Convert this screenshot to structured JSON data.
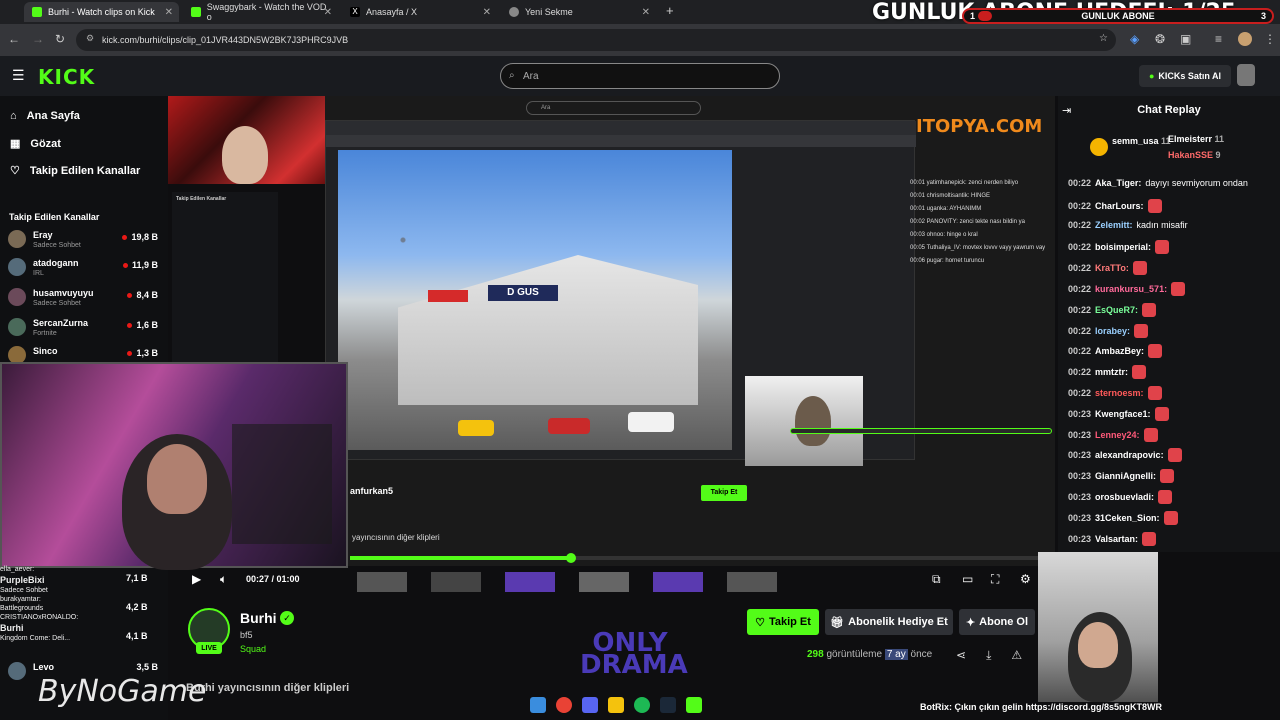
{
  "browser": {
    "tabs": [
      {
        "title": "Burhi - Watch clips on Kick",
        "fav_color": "#53fc18"
      },
      {
        "title": "Swaggybark - Watch the VOD o",
        "fav_color": "#53fc18"
      },
      {
        "title": "Anasayfa / X",
        "fav_color": "#000000"
      },
      {
        "title": "Yeni Sekme",
        "fav_color": "#888888"
      }
    ],
    "url": "kick.com/burhi/clips/clip_01JVR443DN5W2BK7J3PHRC9JVB"
  },
  "overlay_goal": {
    "banner": "GUNLUK ABONE HEDEFI: 1/25",
    "left_num": "1",
    "label": "GUNLUK ABONE",
    "right_num": "3"
  },
  "kick_header": {
    "logo": "KICK",
    "search_placeholder": "Ara",
    "kicks_button": "KICKs Satın Al"
  },
  "sidebar": {
    "nav": [
      {
        "label": "Ana Sayfa",
        "icon": "home-icon"
      },
      {
        "label": "Gözat",
        "icon": "browse-icon"
      },
      {
        "label": "Takip Edilen Kanallar",
        "icon": "heart-icon"
      }
    ],
    "followed_title": "Takip Edilen Kanallar",
    "channels": [
      {
        "name": "Eray",
        "game": "Sadece Sohbet",
        "viewers": "19,8 B",
        "color": "#7a6a55"
      },
      {
        "name": "atadogann",
        "game": "IRL",
        "viewers": "11,9 B",
        "color": "#556b7a"
      },
      {
        "name": "husamvuyuyu",
        "game": "Sadece Sohbet",
        "viewers": "8,4 B",
        "color": "#6b4a5a"
      },
      {
        "name": "SercanZurna",
        "game": "Fortnite",
        "viewers": "1,6 B",
        "color": "#4a6a5a"
      },
      {
        "name": "Sinco",
        "game": "",
        "viewers": "1,3 B",
        "color": "#8a6a3a"
      }
    ]
  },
  "overlay_chat_left": [
    "ella_aever:",
    "PurpleBixi",
    "Sadece Sohbet",
    "burakyamtar:",
    "Battlegrounds",
    "CRISTIANOxRONALDO:",
    "Burhi",
    "Kingdom Come: Deli..."
  ],
  "overlay_side_channels": [
    {
      "name": "PurpleBixi",
      "viewers": "7,1 B"
    },
    {
      "name": "",
      "viewers": "4,2 B"
    },
    {
      "name": "Burhi",
      "viewers": "4,1 B"
    },
    {
      "name": "Levo",
      "viewers": "3,5 B"
    }
  ],
  "video": {
    "watermark": "ITOPYA.COM",
    "inner_chat": [
      "00:01 yatimhanepick: zenci nerden biliyo",
      "00:01 chrismoltisantik: HINGE",
      "00:01 uganka: AYHANIMM",
      "00:02 PANOVITY: zenci tekte nası bildin ya",
      "00:03 ohnoo: hinge o kral",
      "00:05 Tuthaliya_IV: movtex lovvv vayy yawrum vay",
      "00:06 pugar: hornet turuncu"
    ],
    "inner_streamer": "anfurkan5",
    "inner_clips_text": "yayıncısının diğer klipleri",
    "progress_fraction": 0.32,
    "time_current": "00:27",
    "time_total": "01:00"
  },
  "streamer": {
    "name": "Burhi",
    "line2": "bf5",
    "line3": "Squad",
    "live": "LIVE",
    "follow": "Takip Et",
    "gift": "Abonelik Hediye Et",
    "subscribe": "Abone Ol",
    "views_count": "298",
    "views_label": "görüntüleme",
    "age": "7 ay",
    "age_suffix": "önce",
    "clips_caption": "Burhi yayıncısının diğer klipleri"
  },
  "chat": {
    "title": "Chat Replay",
    "pinned": [
      {
        "name": "semm_usa",
        "count": "11"
      },
      {
        "name": "Elmeisterr",
        "count": "11"
      },
      {
        "name": "HakanSSE",
        "count": "9"
      }
    ],
    "messages": [
      {
        "t": "00:22",
        "u": "Aka_Tiger:",
        "m": "dayıyı sevmiyorum ondan",
        "c": "#ffffff",
        "e": false
      },
      {
        "t": "00:22",
        "u": "CharLours:",
        "m": "",
        "c": "#ffffff",
        "e": true
      },
      {
        "t": "00:22",
        "u": "Zelemitt:",
        "m": "kadın misafir",
        "c": "#9ad0ff",
        "e": false
      },
      {
        "t": "00:22",
        "u": "boisimperial:",
        "m": "",
        "c": "#ffffff",
        "e": true
      },
      {
        "t": "00:22",
        "u": "KraTTo:",
        "m": "",
        "c": "#ff7a7a",
        "e": true
      },
      {
        "t": "00:22",
        "u": "kurankursu_571:",
        "m": "",
        "c": "#ff6a9a",
        "e": true
      },
      {
        "t": "00:22",
        "u": "EsQueR7:",
        "m": "",
        "c": "#7aff9a",
        "e": true
      },
      {
        "t": "00:22",
        "u": "lorabey:",
        "m": "",
        "c": "#9ad0ff",
        "e": true
      },
      {
        "t": "00:22",
        "u": "AmbazBey:",
        "m": "",
        "c": "#ffffff",
        "e": true
      },
      {
        "t": "00:22",
        "u": "mmtztr:",
        "m": "",
        "c": "#ffffff",
        "e": true
      },
      {
        "t": "00:22",
        "u": "sternoesm:",
        "m": "",
        "c": "#ff5a5a",
        "e": true
      },
      {
        "t": "00:23",
        "u": "Kwengface1:",
        "m": "",
        "c": "#ffffff",
        "e": true
      },
      {
        "t": "00:23",
        "u": "Lenney24:",
        "m": "",
        "c": "#ff5a7a",
        "e": true
      },
      {
        "t": "00:23",
        "u": "alexandrapovic:",
        "m": "",
        "c": "#ffffff",
        "e": true
      },
      {
        "t": "00:23",
        "u": "GianniAgnelli:",
        "m": "",
        "c": "#ffffff",
        "e": true
      },
      {
        "t": "00:23",
        "u": "orosbuevladi:",
        "m": "",
        "c": "#ffffff",
        "e": true
      },
      {
        "t": "00:23",
        "u": "31Ceken_Sion:",
        "m": "",
        "c": "#ffffff",
        "e": true
      },
      {
        "t": "00:23",
        "u": "Valsartan:",
        "m": "",
        "c": "#ffffff",
        "e": true
      }
    ]
  },
  "bottom_bar": "BotRix: Çıkın çıkın gelin https://discord.gg/8s5ngKT8WR",
  "brand_overlays": {
    "bynogame": "ByNoGame",
    "onlydrama": "ONLY DRAMA"
  },
  "colors": {
    "kick_green": "#53fc18",
    "bg": "#0e0e10",
    "chat_bg": "#131416"
  }
}
